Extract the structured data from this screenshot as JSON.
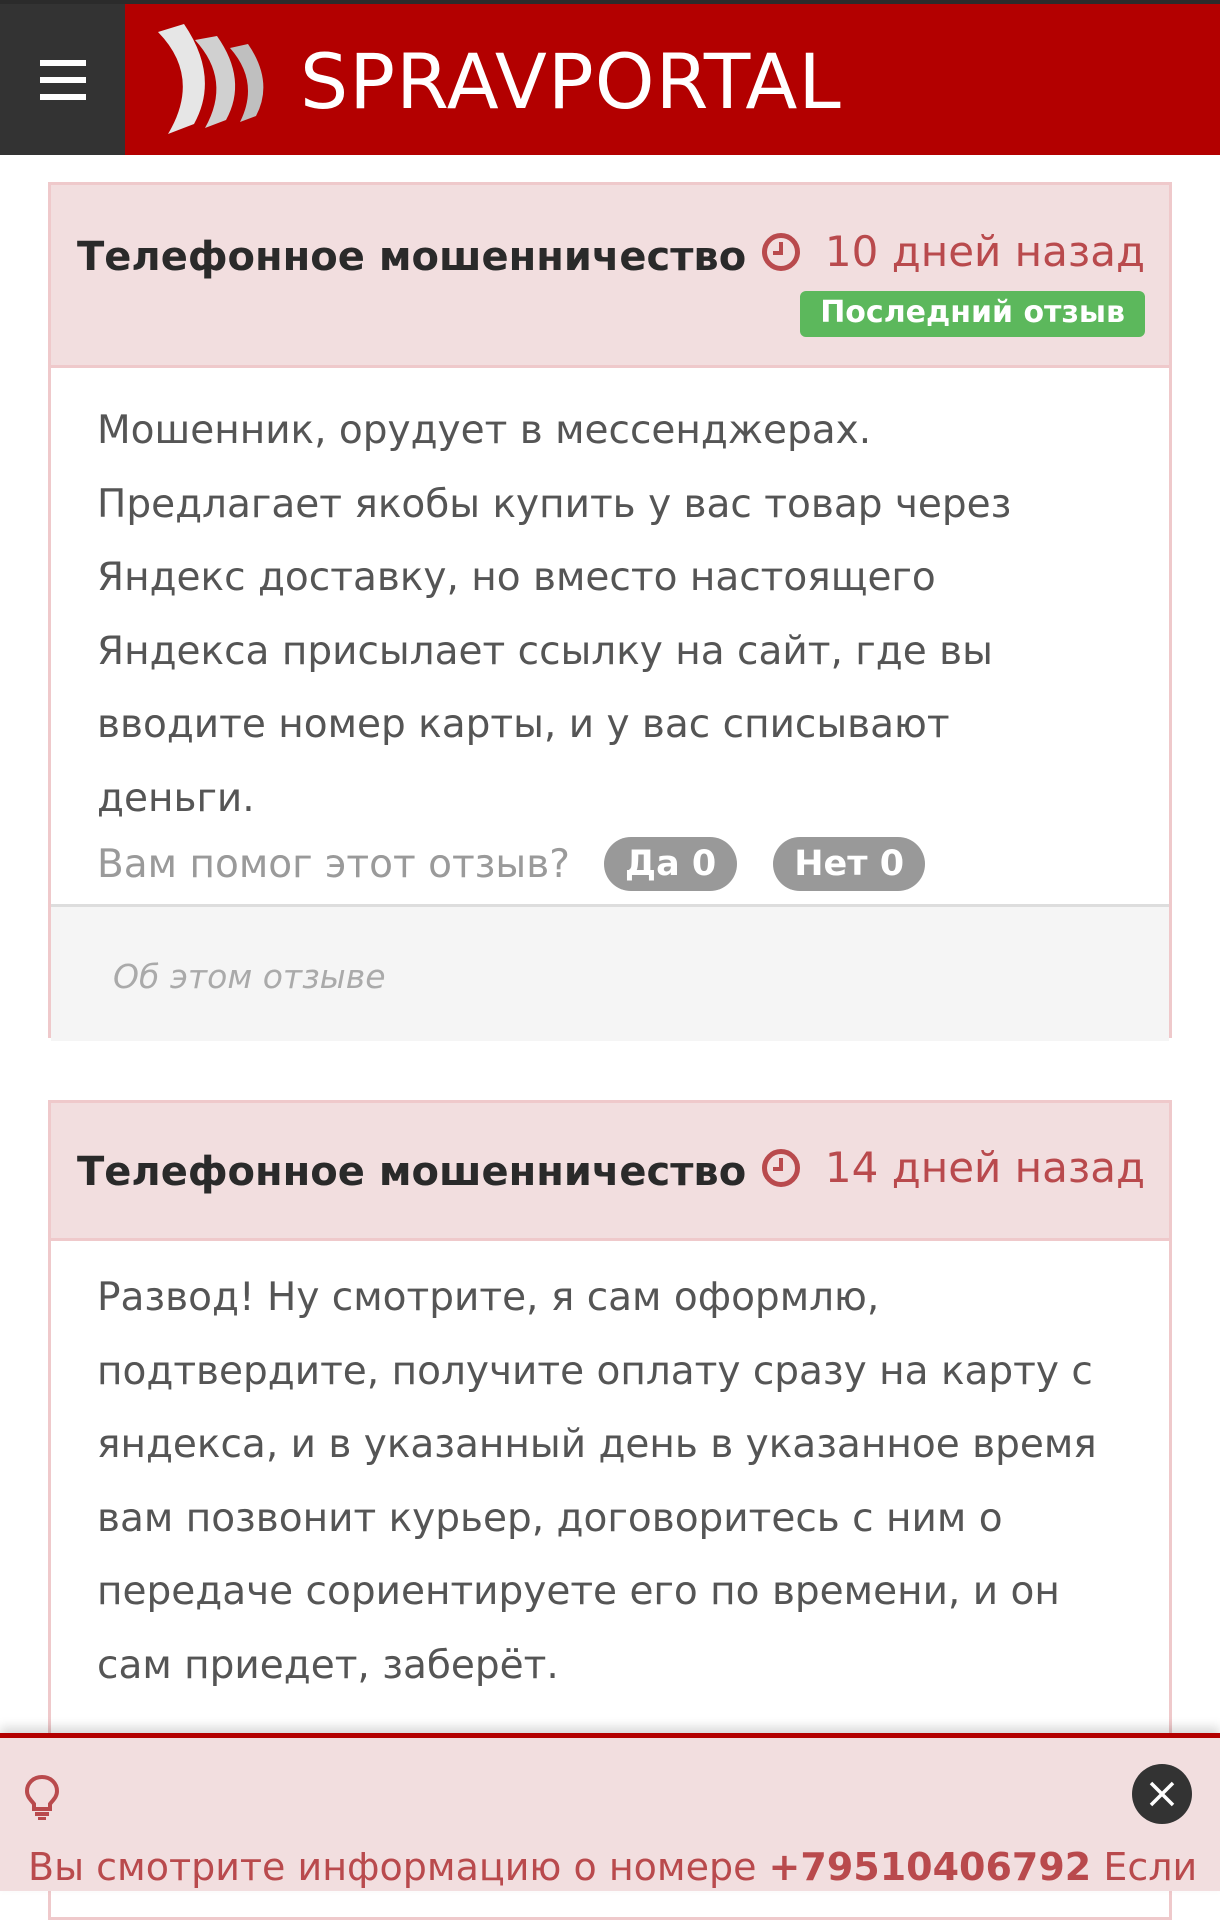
{
  "header": {
    "logo_text": "SPRAVPORTAL"
  },
  "reviews": [
    {
      "title": "Телефонное мошенничество",
      "date": "10 дней назад",
      "badge": "Последний отзыв",
      "text": "Мошенник, орудует в мессенджерах. Предлагает якобы купить у вас товар через Яндекс доставку, но вместо настоящего Яндекса присылает ссылку на сайт, где вы вводите номер карты, и у вас списывают деньги.",
      "helpful_question": "Вам помог этот отзыв?",
      "yes_label": "Да 0",
      "no_label": "Нет 0",
      "about_label": "Об этом отзыве"
    },
    {
      "title": "Телефонное мошенничество",
      "date": "14 дней назад",
      "text": "Развод! Ну смотрите, я сам оформлю, подтвердите, получите оплату сразу на карту с яндекса, и в указанный день в указанное время вам позвонит курьер, договоритесь с ним о передаче сориентируете его по времени, и он сам приедет, заберёт."
    }
  ],
  "notice": {
    "text_before": "Вы смотрите информацию о номере ",
    "phone": "+79510406792",
    "text_after": " Если"
  },
  "colors": {
    "brand_red": "#b30000",
    "card_header_bg": "#f2dedf",
    "badge_green": "#5cb85c",
    "date_red": "#b94a4d"
  },
  "icons": [
    "menu-icon",
    "logo-mark",
    "clock-icon",
    "lightbulb-icon",
    "close-icon"
  ]
}
